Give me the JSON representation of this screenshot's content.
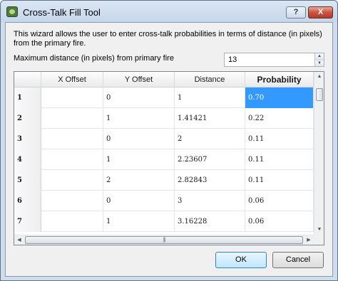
{
  "window": {
    "title": "Cross-Talk Fill Tool",
    "help_label": "?",
    "close_label": "X"
  },
  "description": "This wizard allows the user to enter cross-talk probabilities in terms of distance (in pixels) from the primary fire.",
  "max_distance": {
    "label": "Maximum distance (in pixels) from primary fire",
    "value": "13"
  },
  "table": {
    "columns": [
      "X Offset",
      "Y Offset",
      "Distance",
      "Probability"
    ],
    "rows": [
      {
        "index": "1",
        "x": "",
        "y": "0",
        "distance": "1",
        "probability": "0.70"
      },
      {
        "index": "2",
        "x": "",
        "y": "1",
        "distance": "1.41421",
        "probability": "0.22"
      },
      {
        "index": "3",
        "x": "",
        "y": "0",
        "distance": "2",
        "probability": "0.11"
      },
      {
        "index": "4",
        "x": "",
        "y": "1",
        "distance": "2.23607",
        "probability": "0.11"
      },
      {
        "index": "5",
        "x": "",
        "y": "2",
        "distance": "2.82843",
        "probability": "0.11"
      },
      {
        "index": "6",
        "x": "",
        "y": "0",
        "distance": "3",
        "probability": "0.06"
      },
      {
        "index": "7",
        "x": "",
        "y": "1",
        "distance": "3.16228",
        "probability": "0.06"
      }
    ],
    "selected_cell": "row 1, Probability"
  },
  "buttons": {
    "ok": "OK",
    "cancel": "Cancel"
  },
  "colors": {
    "selection": "#3399ff",
    "title_bar": "#cfdcec",
    "close_button": "#c9543f"
  }
}
